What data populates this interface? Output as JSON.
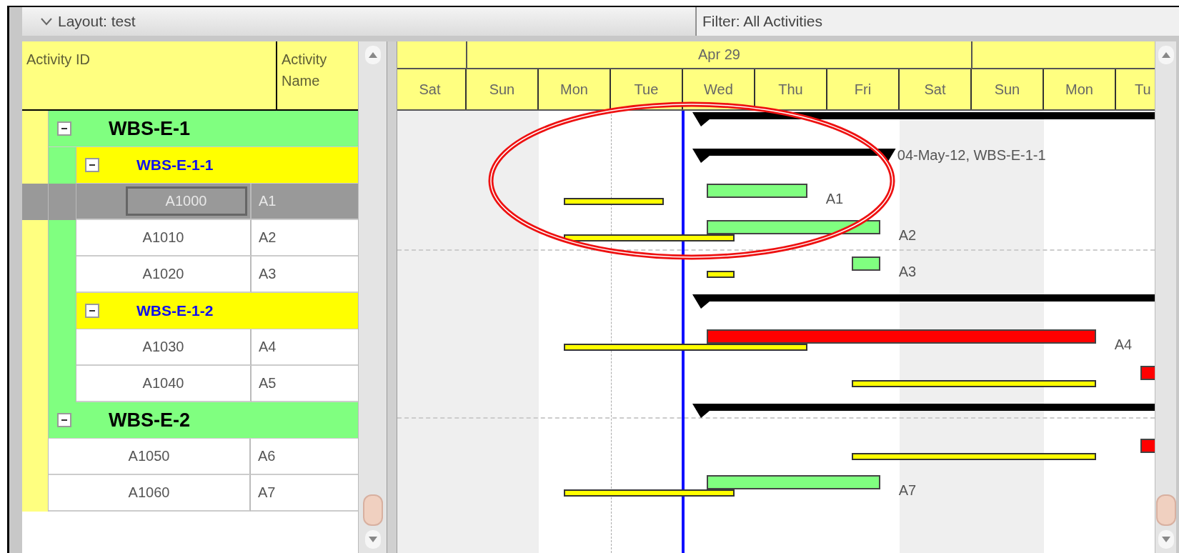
{
  "layout_bar": {
    "label": "Layout: test",
    "expanded": true
  },
  "filter_bar": {
    "label": "Filter: All Activities"
  },
  "table": {
    "columns": [
      "Activity ID",
      "Activity Name"
    ],
    "rows": [
      {
        "kind": "wbs",
        "id": "WBS-E-1",
        "expanded": true,
        "bar": {
          "kind": "summary"
        },
        "children": [
          {
            "kind": "wbs",
            "id": "WBS-E-1-1",
            "expanded": true,
            "bar": {
              "kind": "summary"
            },
            "bar_label": "04-May-12, WBS-E-1-1",
            "children": [
              {
                "kind": "activity",
                "id": "A1000",
                "name": "A1",
                "selected": true,
                "bar": {
                  "kind": "normal"
                },
                "bar_label": "A1"
              },
              {
                "kind": "activity",
                "id": "A1010",
                "name": "A2",
                "selected": false,
                "bar": {
                  "kind": "normal"
                },
                "bar_label": "A2"
              },
              {
                "kind": "activity",
                "id": "A1020",
                "name": "A3",
                "selected": false,
                "bar": {
                  "kind": "normal"
                },
                "bar_label": "A3"
              }
            ]
          },
          {
            "kind": "wbs",
            "id": "WBS-E-1-2",
            "expanded": true,
            "bar": {
              "kind": "summary"
            },
            "children": [
              {
                "kind": "activity",
                "id": "A1030",
                "name": "A4",
                "selected": false,
                "bar": {
                  "kind": "critical"
                },
                "bar_label": "A4"
              },
              {
                "kind": "activity",
                "id": "A1040",
                "name": "A5",
                "selected": false,
                "bar": {
                  "kind": "critical"
                }
              }
            ]
          }
        ]
      },
      {
        "kind": "wbs",
        "id": "WBS-E-2",
        "expanded": true,
        "bar": {
          "kind": "summary"
        },
        "children": [
          {
            "kind": "activity",
            "id": "A1050",
            "name": "A6",
            "selected": false,
            "bar": {
              "kind": "critical"
            }
          },
          {
            "kind": "activity",
            "id": "A1060",
            "name": "A7",
            "selected": false,
            "bar": {
              "kind": "normal"
            },
            "bar_label": "A7"
          }
        ]
      }
    ]
  },
  "timeline": {
    "months": [
      {
        "label": "Apr 29"
      }
    ],
    "days": [
      {
        "label": "Sat",
        "nonwork": true
      },
      {
        "label": "Sun",
        "nonwork": true
      },
      {
        "label": "Mon",
        "nonwork": false
      },
      {
        "label": "Tue",
        "nonwork": false
      },
      {
        "label": "Wed",
        "nonwork": false
      },
      {
        "label": "Thu",
        "nonwork": false
      },
      {
        "label": "Fri",
        "nonwork": false
      },
      {
        "label": "Sat",
        "nonwork": true
      },
      {
        "label": "Sun",
        "nonwork": true
      },
      {
        "label": "Mon",
        "nonwork": false
      },
      {
        "label": "Tu",
        "nonwork": false
      }
    ]
  }
}
